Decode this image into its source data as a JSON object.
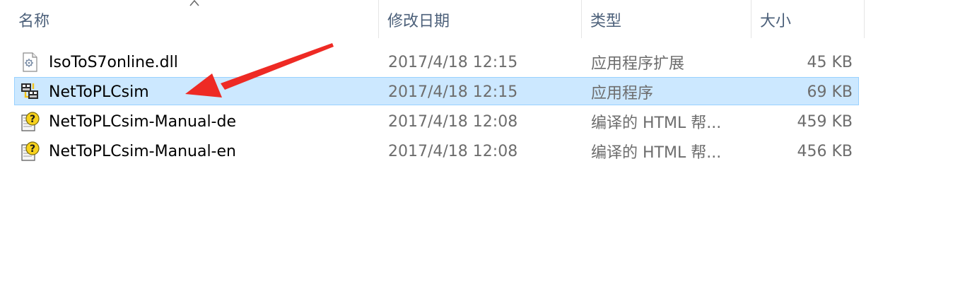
{
  "columns": {
    "name": "名称",
    "date": "修改日期",
    "type": "类型",
    "size": "大小"
  },
  "files": [
    {
      "name": "IsoToS7online.dll",
      "date": "2017/4/18 12:15",
      "type": "应用程序扩展",
      "size": "45 KB",
      "icon": "dll-file-icon",
      "selected": false
    },
    {
      "name": "NetToPLCsim",
      "date": "2017/4/18 12:15",
      "type": "应用程序",
      "size": "69 KB",
      "icon": "application-icon",
      "selected": true
    },
    {
      "name": "NetToPLCsim-Manual-de",
      "date": "2017/4/18 12:08",
      "type": "编译的 HTML 帮...",
      "size": "459 KB",
      "icon": "chm-help-icon",
      "selected": false
    },
    {
      "name": "NetToPLCsim-Manual-en",
      "date": "2017/4/18 12:08",
      "type": "编译的 HTML 帮...",
      "size": "456 KB",
      "icon": "chm-help-icon",
      "selected": false
    }
  ],
  "colors": {
    "selection_fill": "#cce8ff",
    "selection_border": "#99d1ff",
    "annotation_arrow": "#ee2a24"
  }
}
